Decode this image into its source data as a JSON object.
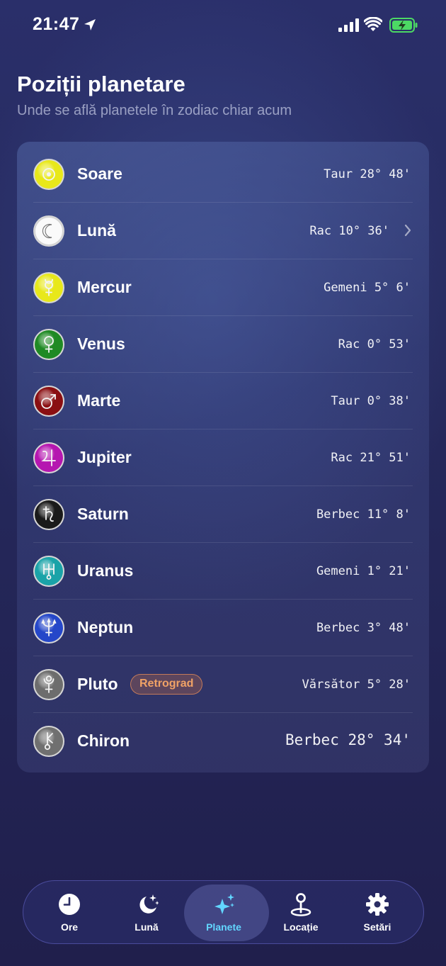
{
  "status_bar": {
    "time": "21:47"
  },
  "header": {
    "title": "Poziții planetare",
    "subtitle": "Unde se află planetele în zodiac chiar acum"
  },
  "planets": [
    {
      "name": "Soare",
      "position": "Taur 28° 48'",
      "color": "#e8e81a",
      "glyph": "sun"
    },
    {
      "name": "Lună",
      "position": "Rac 10° 36'",
      "color": "#e6e6e6",
      "glyph": "moon",
      "has_chevron": true
    },
    {
      "name": "Mercur",
      "position": "Gemeni 5° 6'",
      "color": "#e8e81a",
      "glyph": "mercury"
    },
    {
      "name": "Venus",
      "position": "Rac 0° 53'",
      "color": "#1f8a24",
      "glyph": "venus"
    },
    {
      "name": "Marte",
      "position": "Taur 0° 38'",
      "color": "#8a0f12",
      "glyph": "mars"
    },
    {
      "name": "Jupiter",
      "position": "Rac 21° 51'",
      "color": "#b516b0",
      "glyph": "jupiter"
    },
    {
      "name": "Saturn",
      "position": "Berbec 11° 8'",
      "color": "#1a1a1a",
      "glyph": "saturn"
    },
    {
      "name": "Uranus",
      "position": "Gemeni 1° 21'",
      "color": "#1aa3a8",
      "glyph": "uranus"
    },
    {
      "name": "Neptun",
      "position": "Berbec 3° 48'",
      "color": "#2547c9",
      "glyph": "neptune"
    },
    {
      "name": "Pluto",
      "position": "Vărsător 5° 28'",
      "color": "#6d6d6d",
      "glyph": "pluto",
      "badge": "Retrograd"
    },
    {
      "name": "Chiron",
      "position": "Berbec 28° 34'",
      "color": "#707070",
      "glyph": "chiron",
      "large": true
    }
  ],
  "tabs": [
    {
      "label": "Ore",
      "icon": "clock-icon"
    },
    {
      "label": "Lună",
      "icon": "moon-stars-icon"
    },
    {
      "label": "Planete",
      "icon": "sparkles-icon",
      "active": true
    },
    {
      "label": "Locație",
      "icon": "location-pin-icon"
    },
    {
      "label": "Setări",
      "icon": "gear-icon"
    }
  ]
}
